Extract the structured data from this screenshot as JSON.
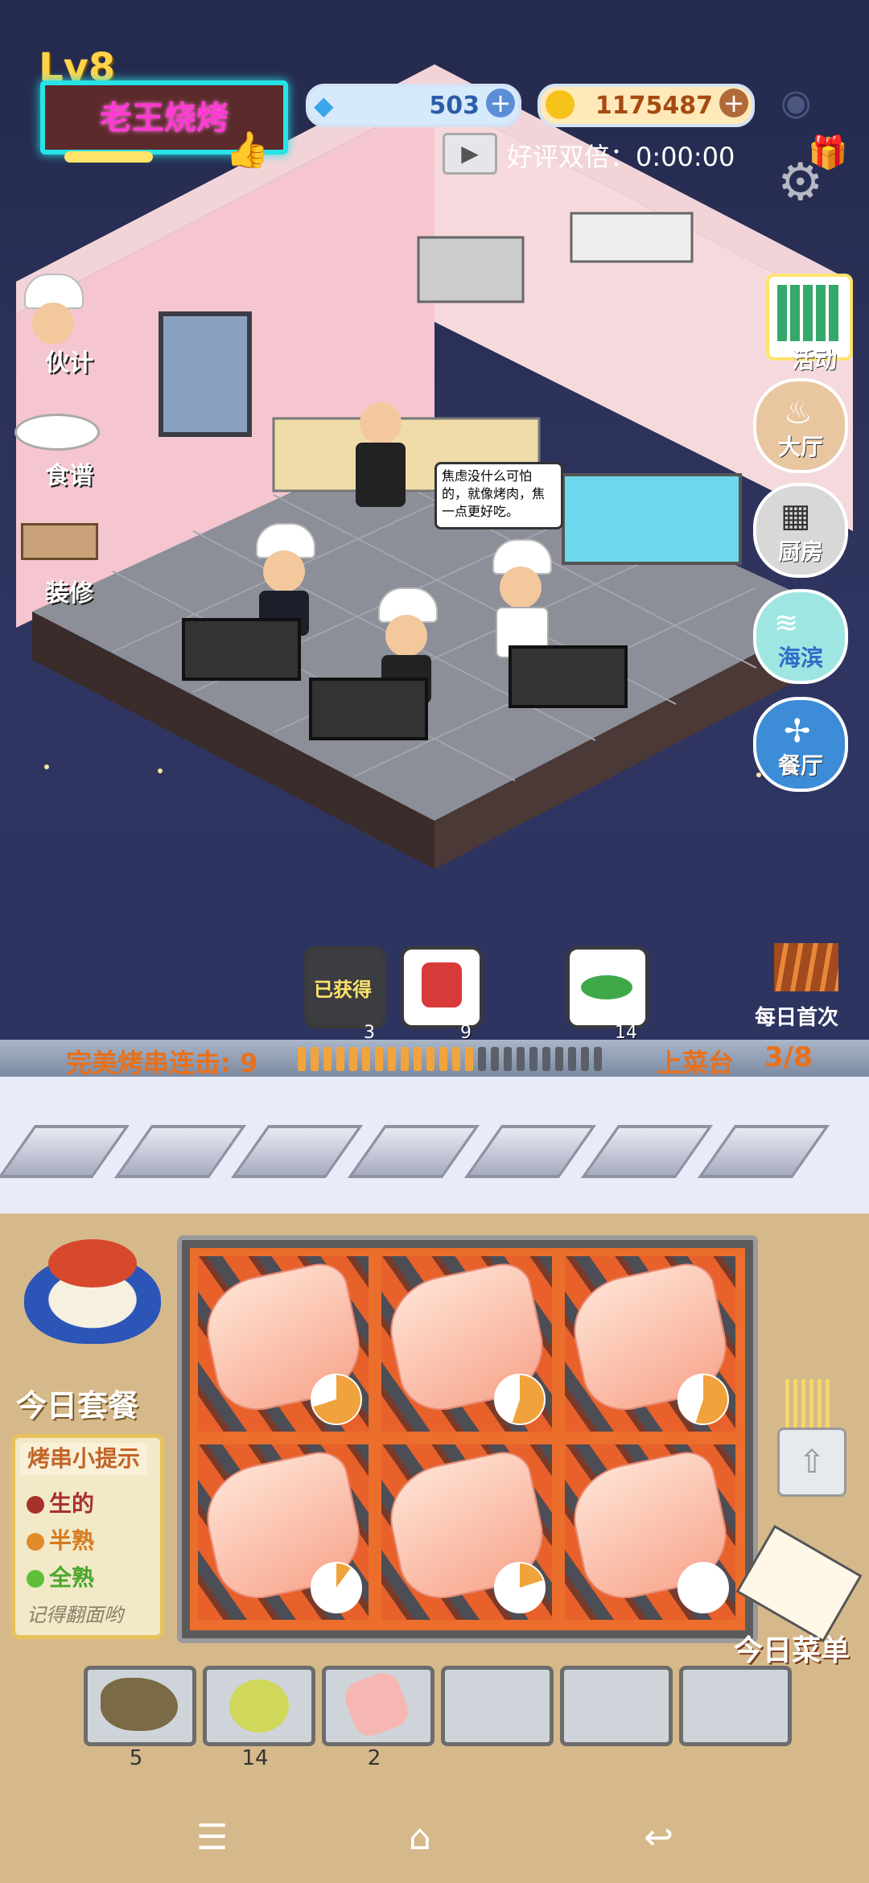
{
  "hud": {
    "level": "Lv8",
    "shop_name": "老王烧烤",
    "diamonds": "503",
    "coins": "1175487",
    "double_reward": "好评双倍：0:00:00"
  },
  "left_menu": {
    "staff": "伙计",
    "recipes": "食谱",
    "decorate": "装修"
  },
  "right_menu": {
    "activity": "活动",
    "hall": "大厅",
    "kitchen": "厨房",
    "seaside": "海滨",
    "restaurant": "餐厅"
  },
  "speech_bubble": "焦虑没什么可怕的，就像烤肉，焦一点更好吃。",
  "items": [
    {
      "label": "已获得",
      "count": "3"
    },
    {
      "label": "",
      "count": "9"
    },
    {
      "label": "",
      "count": "14"
    }
  ],
  "daily_first": "每日首次",
  "combo": {
    "label": "完美烤串连击: 9",
    "progress_filled": 14,
    "progress_total": 24,
    "serving_label": "上菜台",
    "serving_count": "3/8"
  },
  "grill": {
    "cooking_progress": [
      0.7,
      0.55,
      0.55,
      0.1,
      0.2,
      0.0
    ]
  },
  "today_set": "今日套餐",
  "tips": {
    "title": "烤串小提示",
    "raw": "生的",
    "half": "半熟",
    "done": "全熟",
    "note": "记得翻面哟",
    "colors": {
      "raw": "#a7312d",
      "half": "#e08a2a",
      "done": "#5fbf3a"
    }
  },
  "today_menu": "今日菜单",
  "inventory": [
    {
      "count": "5"
    },
    {
      "count": "14"
    },
    {
      "count": "2"
    },
    {
      "count": ""
    },
    {
      "count": ""
    },
    {
      "count": ""
    }
  ]
}
